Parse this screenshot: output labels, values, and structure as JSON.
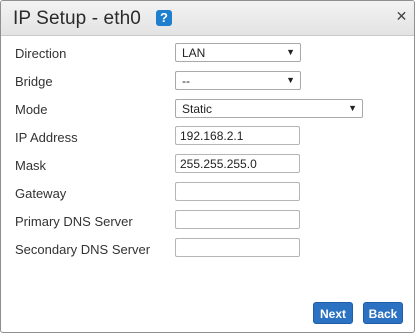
{
  "dialog": {
    "title": "IP Setup - eth0",
    "help_icon": "?",
    "close_icon": "✕"
  },
  "fields": {
    "direction": {
      "label": "Direction",
      "value": "LAN"
    },
    "bridge": {
      "label": "Bridge",
      "value": "--"
    },
    "mode": {
      "label": "Mode",
      "value": "Static"
    },
    "ip_address": {
      "label": "IP Address",
      "value": "192.168.2.1"
    },
    "mask": {
      "label": "Mask",
      "value": "255.255.255.0"
    },
    "gateway": {
      "label": "Gateway",
      "value": ""
    },
    "primary_dns": {
      "label": "Primary DNS Server",
      "value": ""
    },
    "secondary_dns": {
      "label": "Secondary DNS Server",
      "value": ""
    }
  },
  "icons": {
    "dropdown_arrow": "▼"
  },
  "buttons": {
    "next": "Next",
    "back": "Back"
  },
  "colors": {
    "button_blue": "#2b72c2",
    "help_blue": "#1f7fcf"
  }
}
